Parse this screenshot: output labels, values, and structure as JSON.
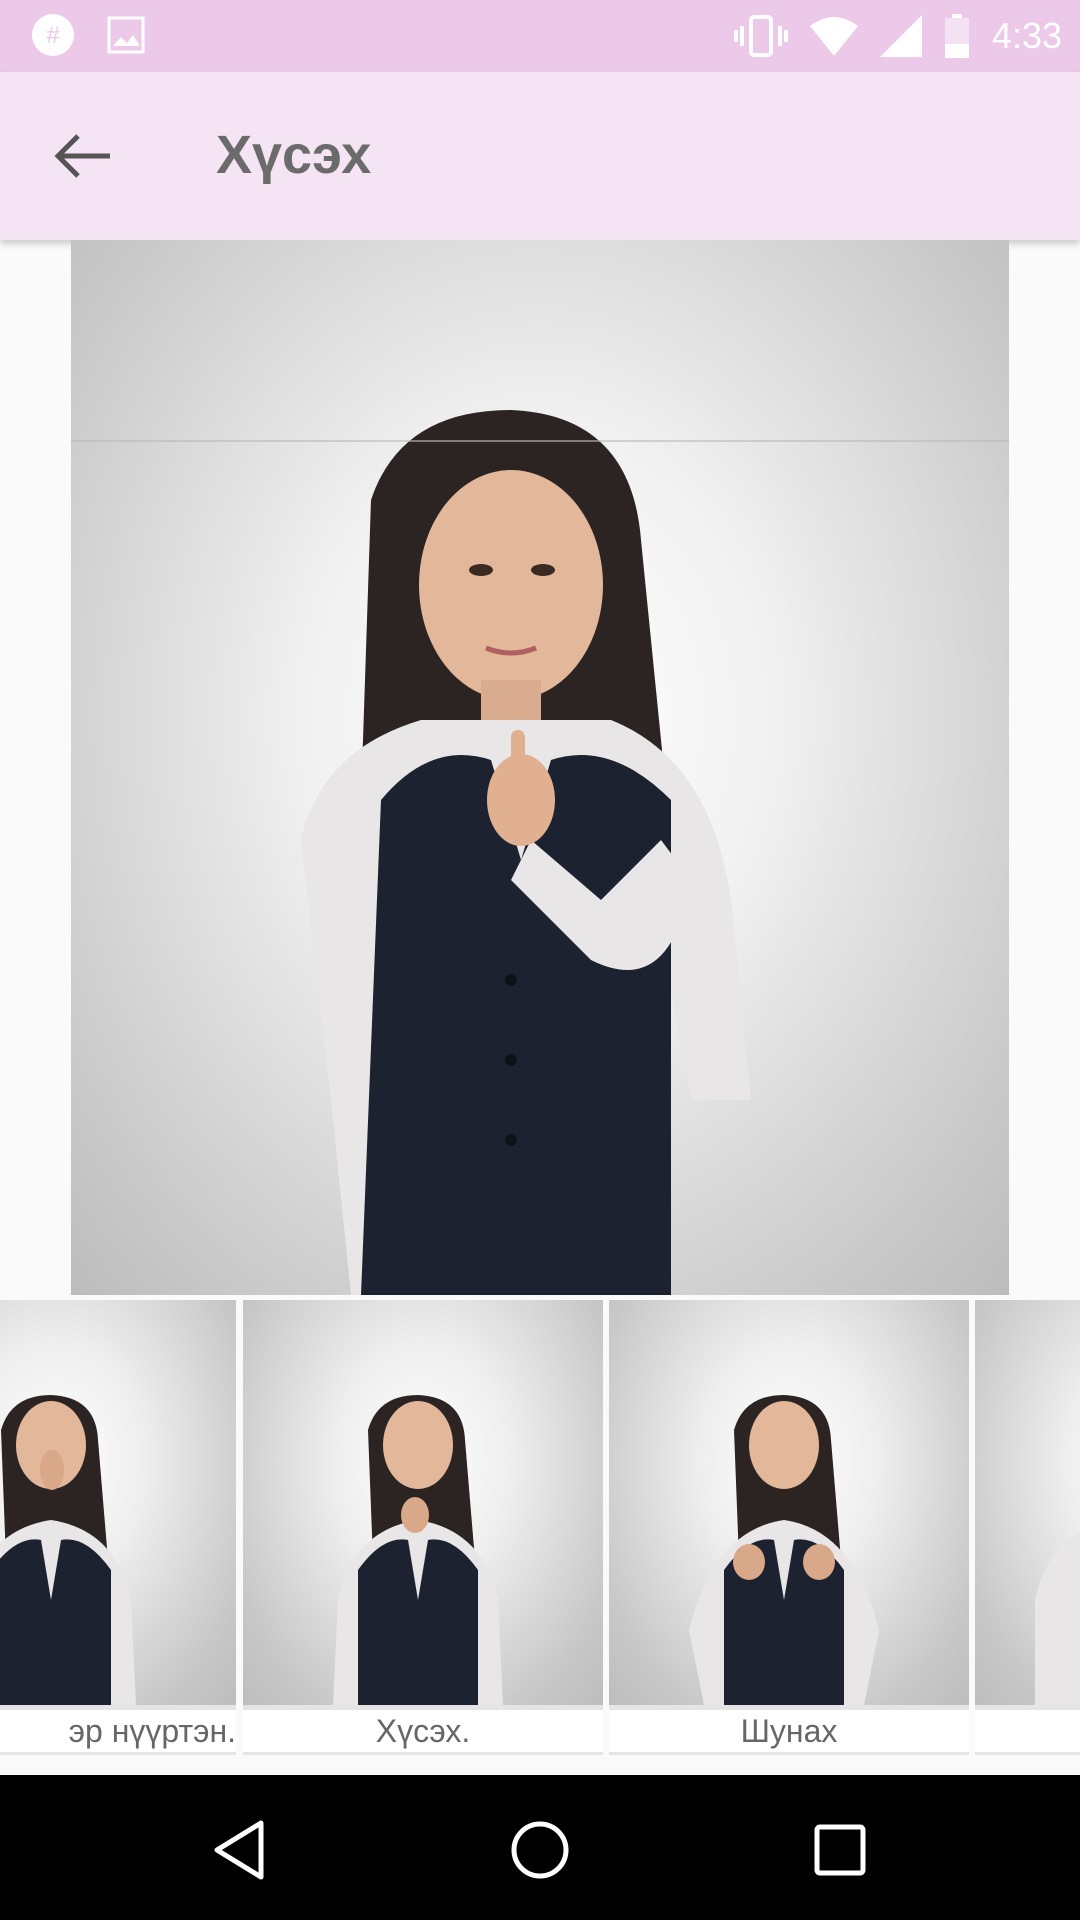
{
  "status_bar": {
    "time": "4:33",
    "icons": [
      "app-notification-icon",
      "image-notification-icon",
      "vibrate-icon",
      "wifi-icon",
      "signal-icon",
      "battery-icon"
    ]
  },
  "app_bar": {
    "title": "Хүсэх",
    "back_icon": "arrow-left-icon",
    "background": "#f5e4f4"
  },
  "main_image": {
    "subject": "woman-pointing-chin"
  },
  "thumbnails": [
    {
      "caption": "эр нүүртэн."
    },
    {
      "caption": "Хүсэх."
    },
    {
      "caption": "Шунах"
    },
    {
      "caption": ""
    }
  ],
  "nav_bar": {
    "buttons": [
      "back-triangle-icon",
      "home-circle-icon",
      "recents-square-icon"
    ]
  }
}
